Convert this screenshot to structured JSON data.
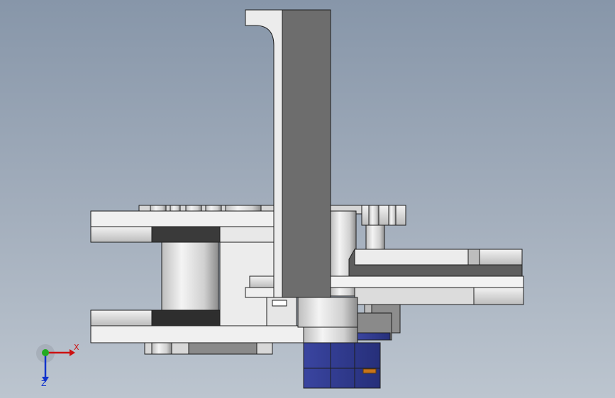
{
  "app": {
    "view": "CAD 3D viewport",
    "background_top": "#8796a9",
    "background_bottom": "#bcc5cf"
  },
  "colors": {
    "part_light": "#e6e6e6",
    "part_mid": "#c8c8c8",
    "part_dark": "#707070",
    "part_black": "#2e2e2e",
    "motor_blue": "#2e3a8f",
    "edge": "#1e1e1e",
    "axis_x": "#cc1111",
    "axis_y": "#22aa22",
    "axis_z": "#1133cc"
  },
  "triad": {
    "x_label": "X",
    "z_label": "Z",
    "icon": "coordinate-triad-icon"
  }
}
